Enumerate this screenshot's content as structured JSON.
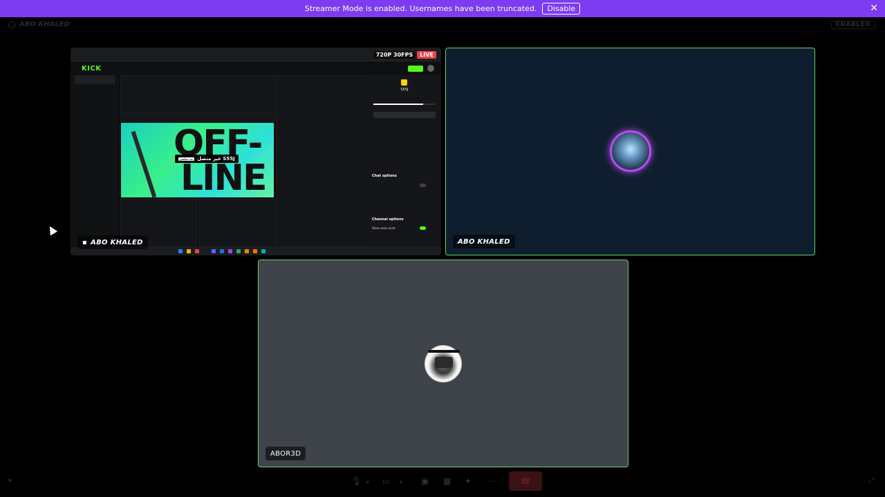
{
  "banner": {
    "message": "Streamer Mode is enabled. Usernames have been truncated.",
    "disable_label": "Disable",
    "close_icon": "✕"
  },
  "topbar": {
    "channel_name": "ABO KHALED",
    "enabled_label": "ENABLED"
  },
  "tiles": {
    "screen": {
      "resolution": "720P 30FPS",
      "live": "LIVE",
      "label": "ABO KHALED",
      "kick": {
        "logo": "KICK",
        "streamer": "S55J",
        "offline_line1": "OFF-",
        "offline_line2": "LINE",
        "offline_badge": "غير متصل S55J",
        "offline_pill": "بث مباشر",
        "chat_options": "Chat options",
        "channel_options": "Channel options",
        "show_view_count": "Show view count"
      }
    },
    "avatar": {
      "label": "ABO KHALED"
    },
    "user": {
      "label": "ABOR3D"
    }
  },
  "icons": {
    "monitor": "monitor-icon",
    "mic": "microphone-icon",
    "camera": "camera-icon",
    "share": "screen-share-icon",
    "grid": "grid-icon",
    "activity": "activity-icon",
    "more": "more-icon",
    "end": "end-call-icon"
  },
  "colors": {
    "banner": "#7d3cf1",
    "speaking_border": "#69d26c",
    "live": "#ed4245",
    "kick_green": "#53fc18"
  }
}
